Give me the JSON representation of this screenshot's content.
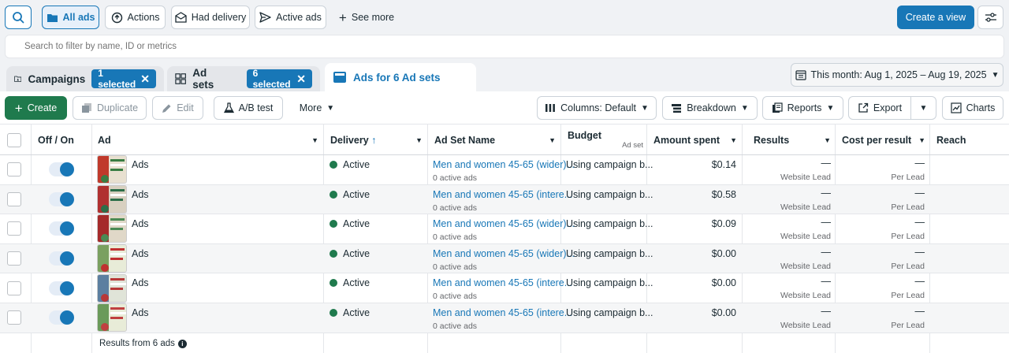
{
  "toolbar": {
    "all_ads": "All ads",
    "actions": "Actions",
    "had_delivery": "Had delivery",
    "active_ads": "Active ads",
    "see_more": "See more",
    "create_view": "Create a view"
  },
  "search": {
    "placeholder": "Search to filter by name, ID or metrics"
  },
  "tabs": {
    "campaigns": "Campaigns",
    "campaigns_selected": "1 selected",
    "adsets": "Ad sets",
    "adsets_selected": "6 selected",
    "ads": "Ads for 6 Ad sets"
  },
  "date_range": "This month: Aug 1, 2025 – Aug 19, 2025",
  "actions": {
    "create": "Create",
    "duplicate": "Duplicate",
    "edit": "Edit",
    "ab_test": "A/B test",
    "more": "More",
    "columns": "Columns: Default",
    "breakdown": "Breakdown",
    "reports": "Reports",
    "export": "Export",
    "charts": "Charts"
  },
  "columns": {
    "off_on": "Off / On",
    "ad": "Ad",
    "delivery": "Delivery",
    "ad_set_name": "Ad Set Name",
    "budget": "Budget",
    "budget_sub": "Ad set",
    "amount_spent": "Amount spent",
    "results": "Results",
    "cost_per_result": "Cost per result",
    "reach": "Reach"
  },
  "rows": [
    {
      "ad": "Ads",
      "delivery": "Active",
      "adset": "Men and women 45-65 (wider)...",
      "adset_sub": "0 active ads",
      "budget": "Using campaign b...",
      "spent": "$0.14",
      "results": "—",
      "results_sub": "Website Lead",
      "cpr": "—",
      "cpr_sub": "Per Lead",
      "on": true
    },
    {
      "ad": "Ads",
      "delivery": "Active",
      "adset": "Men and women 45-65 (intere...",
      "adset_sub": "0 active ads",
      "budget": "Using campaign b...",
      "spent": "$0.58",
      "results": "—",
      "results_sub": "Website Lead",
      "cpr": "—",
      "cpr_sub": "Per Lead",
      "on": true
    },
    {
      "ad": "Ads",
      "delivery": "Active",
      "adset": "Men and women 45-65 (wider)...",
      "adset_sub": "0 active ads",
      "budget": "Using campaign b...",
      "spent": "$0.09",
      "results": "—",
      "results_sub": "Website Lead",
      "cpr": "—",
      "cpr_sub": "Per Lead",
      "on": true
    },
    {
      "ad": "Ads",
      "delivery": "Active",
      "adset": "Men and women 45-65 (wider)...",
      "adset_sub": "0 active ads",
      "budget": "Using campaign b...",
      "spent": "$0.00",
      "results": "—",
      "results_sub": "Website Lead",
      "cpr": "—",
      "cpr_sub": "Per Lead",
      "on": true
    },
    {
      "ad": "Ads",
      "delivery": "Active",
      "adset": "Men and women 45-65 (intere...",
      "adset_sub": "0 active ads",
      "budget": "Using campaign b...",
      "spent": "$0.00",
      "results": "—",
      "results_sub": "Website Lead",
      "cpr": "—",
      "cpr_sub": "Per Lead",
      "on": true
    },
    {
      "ad": "Ads",
      "delivery": "Active",
      "adset": "Men and women 45-65 (intere...",
      "adset_sub": "0 active ads",
      "budget": "Using campaign b...",
      "spent": "$0.00",
      "results": "—",
      "results_sub": "Website Lead",
      "cpr": "—",
      "cpr_sub": "Per Lead",
      "on": true
    }
  ],
  "footer": {
    "results_from": "Results from 6 ads"
  },
  "colors": {
    "accent": "#1877b7",
    "active": "#1f7a4d",
    "create": "#1f7a4d"
  }
}
